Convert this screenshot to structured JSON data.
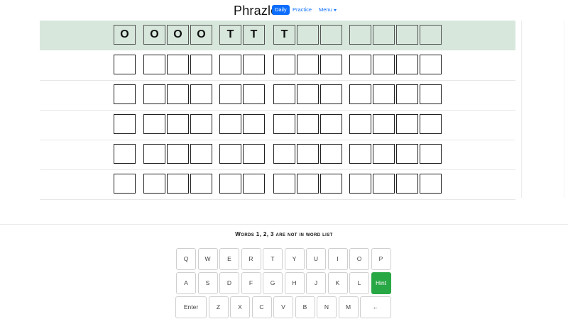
{
  "header": {
    "title": "Phrazle",
    "nav": {
      "daily": "Daily",
      "practice": "Practice",
      "menu": "Menu"
    }
  },
  "board": {
    "rows": [
      {
        "active": true,
        "words": [
          [
            "O"
          ],
          [
            "O",
            "O",
            "O"
          ],
          [
            "T",
            "T"
          ],
          [
            "T",
            "",
            ""
          ],
          [
            "",
            "",
            "",
            ""
          ]
        ]
      },
      {
        "active": false,
        "words": [
          [
            ""
          ],
          [
            "",
            "",
            ""
          ],
          [
            "",
            ""
          ],
          [
            "",
            "",
            ""
          ],
          [
            "",
            "",
            "",
            ""
          ]
        ]
      },
      {
        "active": false,
        "words": [
          [
            ""
          ],
          [
            "",
            "",
            ""
          ],
          [
            "",
            ""
          ],
          [
            "",
            "",
            ""
          ],
          [
            "",
            "",
            "",
            ""
          ]
        ]
      },
      {
        "active": false,
        "words": [
          [
            ""
          ],
          [
            "",
            "",
            ""
          ],
          [
            "",
            ""
          ],
          [
            "",
            "",
            ""
          ],
          [
            "",
            "",
            "",
            ""
          ]
        ]
      },
      {
        "active": false,
        "words": [
          [
            ""
          ],
          [
            "",
            "",
            ""
          ],
          [
            "",
            ""
          ],
          [
            "",
            "",
            ""
          ],
          [
            "",
            "",
            "",
            ""
          ]
        ]
      },
      {
        "active": false,
        "words": [
          [
            ""
          ],
          [
            "",
            "",
            ""
          ],
          [
            "",
            ""
          ],
          [
            "",
            "",
            ""
          ],
          [
            "",
            "",
            "",
            ""
          ]
        ]
      }
    ]
  },
  "message": "Words 1, 2, 3 are not in word list",
  "keyboard": {
    "rows": [
      [
        "Q",
        "W",
        "E",
        "R",
        "T",
        "Y",
        "U",
        "I",
        "O",
        "P"
      ],
      [
        "A",
        "S",
        "D",
        "F",
        "G",
        "H",
        "J",
        "K",
        "L",
        "Hint"
      ],
      [
        "Enter",
        "Z",
        "X",
        "C",
        "V",
        "B",
        "N",
        "M",
        "←"
      ]
    ],
    "hint_color": "#28a745"
  },
  "colors": {
    "active_row": "#d7e7dc",
    "accent": "#0d6efd"
  }
}
